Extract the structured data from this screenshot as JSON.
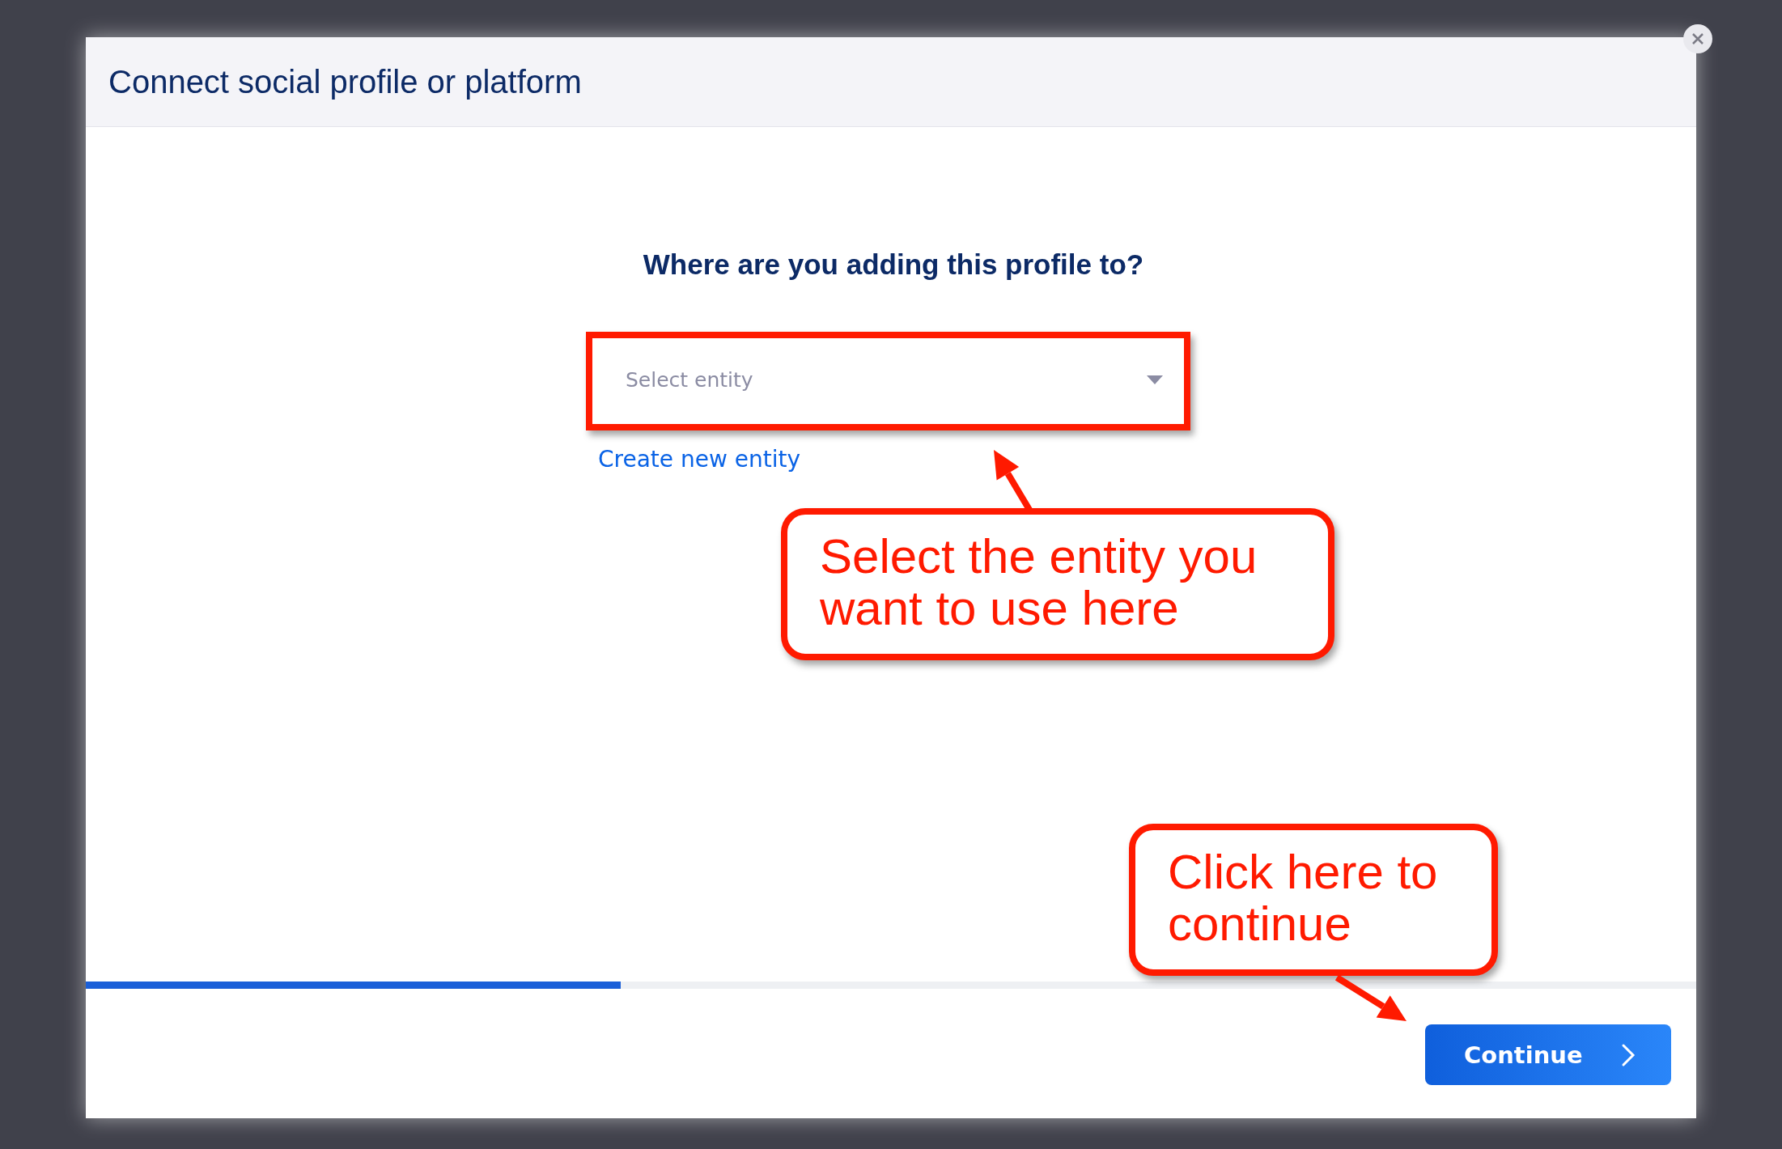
{
  "dialog": {
    "title": "Connect social profile or platform",
    "question": "Where are you adding this profile to?",
    "entity_select": {
      "placeholder": "Select entity"
    },
    "create_link": "Create new entity",
    "progress": {
      "level": 0.332
    },
    "continue_button": "Continue"
  },
  "annotations": [
    {
      "kind": "highlight"
    },
    {
      "kind": "callout",
      "text": "Select the entity you want to use here"
    },
    {
      "kind": "callout",
      "text": "Click here to continue"
    }
  ]
}
